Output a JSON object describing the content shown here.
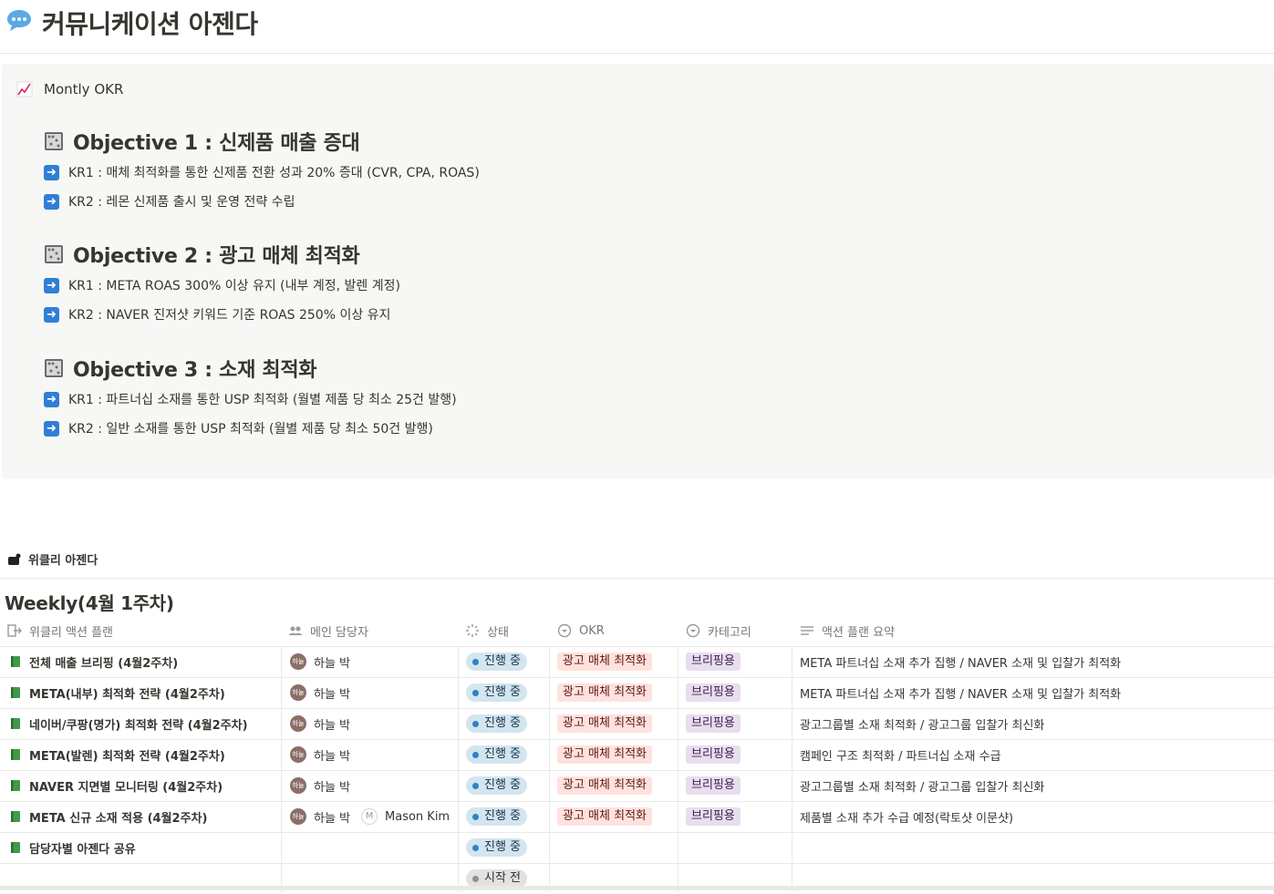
{
  "page": {
    "title": "커뮤니케이션 아젠다",
    "icon": "speech-bubble-icon"
  },
  "okr_callout": {
    "heading": "Montly OKR",
    "objectives": [
      {
        "title": "Objective 1 : 신제품 매출 증대",
        "krs": [
          "KR1 : 매체 최적화를 통한 신제품 전환 성과 20% 증대 (CVR, CPA, ROAS)",
          "KR2 : 레몬 신제품 출시 및 운영 전략 수립"
        ]
      },
      {
        "title": "Objective 2 : 광고 매체 최적화",
        "krs": [
          "KR1 : META ROAS 300% 이상 유지 (내부 계정, 발렌 계정)",
          "KR2 : NAVER 진저샷 키워드 기준 ROAS 250% 이상 유지"
        ]
      },
      {
        "title": "Objective 3 : 소재 최적화",
        "krs": [
          "KR1 : 파트너십 소재를 통한 USP 최적화 (월별 제품 당 최소 25건 발행)",
          "KR2 : 일반 소재를 통한 USP 최적화 (월별 제품 당 최소 50건 발행)"
        ]
      }
    ]
  },
  "weekly": {
    "heading": "위클리 아젠다",
    "view_title": "Weekly(4월 1주차)",
    "columns": [
      "위클리 액션 플랜",
      "메인 담당자",
      "상태",
      "OKR",
      "카테고리",
      "액션 플랜 요약"
    ],
    "rows": [
      {
        "name": "전체 매출 브리핑 (4월2주차)",
        "owner": "하늘 박",
        "owner_avatar": "하늘",
        "owner2": "",
        "status": "진행 중",
        "okr": "광고 매체 최적화",
        "category": "브리핑용",
        "summary": "META 파트너십 소재 추가 집행 / NAVER 소재 및 입찰가 최적화"
      },
      {
        "name": "META(내부) 최적화 전략 (4월2주차)",
        "owner": "하늘 박",
        "owner_avatar": "하늘",
        "owner2": "",
        "status": "진행 중",
        "okr": "광고 매체 최적화",
        "category": "브리핑용",
        "summary": "META 파트너십 소재 추가 집행 / NAVER 소재 및 입찰가 최적화"
      },
      {
        "name": "네이버/쿠팡(명가) 최적화 전략 (4월2주차)",
        "owner": "하늘 박",
        "owner_avatar": "하늘",
        "owner2": "",
        "status": "진행 중",
        "okr": "광고 매체 최적화",
        "category": "브리핑용",
        "summary": "광고그룹별 소재 최적화 / 광고그룹 입찰가 최신화"
      },
      {
        "name": "META(발렌) 최적화 전략 (4월2주차)",
        "owner": "하늘 박",
        "owner_avatar": "하늘",
        "owner2": "",
        "status": "진행 중",
        "okr": "광고 매체 최적화",
        "category": "브리핑용",
        "summary": "캠페인 구조 최적화 / 파트너십 소재 수급"
      },
      {
        "name": "NAVER 지면별 모니터링 (4월2주차)",
        "owner": "하늘 박",
        "owner_avatar": "하늘",
        "owner2": "",
        "status": "진행 중",
        "okr": "광고 매체 최적화",
        "category": "브리핑용",
        "summary": "광고그룹별 소재 최적화 / 광고그룹 입찰가 최신화"
      },
      {
        "name": "META 신규 소재 적용 (4월2주차)",
        "owner": "하늘 박",
        "owner_avatar": "하늘",
        "owner2": "Mason Kim",
        "owner2_avatar": "M",
        "status": "진행 중",
        "okr": "광고 매체 최적화",
        "category": "브리핑용",
        "summary": "제품별 소재 추가 수급 예정(락토샷 이문샷)"
      },
      {
        "name": "담당자별 아젠다 공유",
        "owner": "",
        "owner2": "",
        "status": "진행 중",
        "okr": "",
        "category": "",
        "summary": ""
      },
      {
        "name": "",
        "owner": "",
        "owner2": "",
        "status": "시작 전",
        "okr": "",
        "category": "",
        "summary": ""
      }
    ]
  },
  "colors": {
    "status_blue": "#d3e5ef",
    "okr_red": "#ffe2dd",
    "category_purple": "#e8deee",
    "callout_bg": "#f7f7f5"
  }
}
